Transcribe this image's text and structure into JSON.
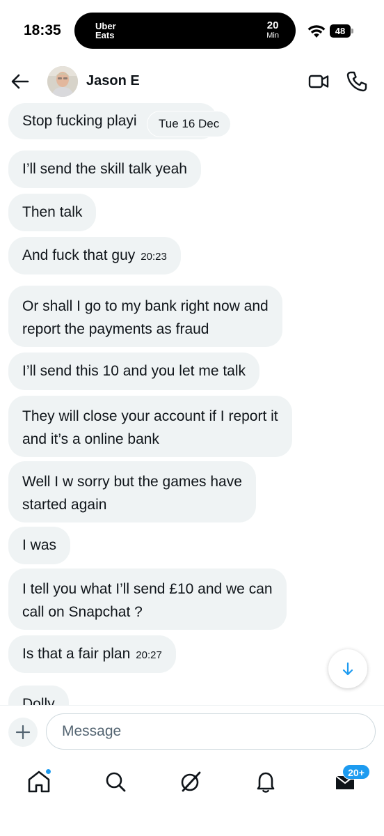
{
  "status_bar": {
    "time": "18:35",
    "island_logo_line1": "Uber",
    "island_logo_line2": "Eats",
    "eta_value": "20",
    "eta_unit": "Min",
    "battery": "48"
  },
  "header": {
    "contact_name": "Jason E"
  },
  "conversation": {
    "date_divider": "Tue 16 Dec",
    "messages": [
      {
        "text": "Stop fucking playi"
      },
      {
        "text": "I’ll send the skill talk yeah"
      },
      {
        "text": "Then talk"
      },
      {
        "text": "And fuck that guy",
        "time": "20:23"
      },
      {
        "line1": "Or shall I go to my bank right now and",
        "line2": "report the payments as fraud"
      },
      {
        "text": "I’ll send this 10 and you let me talk"
      },
      {
        "line1": "They will close your account if I report it",
        "line2": "and it’s a online bank"
      },
      {
        "line1": "Well I w sorry but the games have",
        "line2": "started again"
      },
      {
        "text": "I was"
      },
      {
        "line1": "I tell you what I’ll send £10 and we can",
        "line2": "call on Snapchat ?"
      },
      {
        "text": "Is that a fair plan",
        "time": "20:27"
      },
      {
        "text": "Dolly"
      }
    ]
  },
  "composer": {
    "placeholder": "Message"
  },
  "bottom_nav": {
    "messages_badge": "20+"
  },
  "colors": {
    "accent": "#1d9bf0",
    "bubble": "#eff3f4",
    "text": "#0f1419"
  }
}
